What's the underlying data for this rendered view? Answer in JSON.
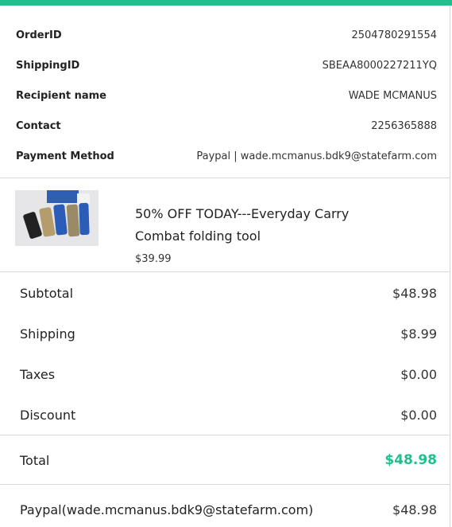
{
  "order": {
    "rows": [
      {
        "label": "OrderID",
        "value": "2504780291554"
      },
      {
        "label": "ShippingID",
        "value": "SBEAA8000227211YQ"
      },
      {
        "label": "Recipient name",
        "value": "WADE MCMANUS"
      },
      {
        "label": "Contact",
        "value": "2256365888"
      },
      {
        "label": "Payment Method",
        "value": "Paypal | wade.mcmanus.bdk9@statefarm.com"
      }
    ]
  },
  "product": {
    "title_line1": "50% OFF TODAY---Everyday Carry",
    "title_line2": "Combat folding tool",
    "price": "$39.99"
  },
  "summary": {
    "subtotal_label": "Subtotal",
    "subtotal_value": "$48.98",
    "shipping_label": "Shipping",
    "shipping_value": "$8.99",
    "taxes_label": "Taxes",
    "taxes_value": "$0.00",
    "discount_label": "Discount",
    "discount_value": "$0.00",
    "total_label": "Total",
    "total_value": "$48.98",
    "payment_label": "Paypal(wade.mcmanus.bdk9@statefarm.com)",
    "payment_value": "$48.98"
  },
  "colors": {
    "accent": "#1fbf8f",
    "divider": "#d7d7d7"
  }
}
